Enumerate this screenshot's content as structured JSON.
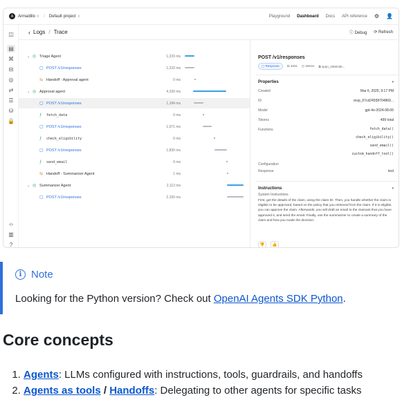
{
  "topbar": {
    "org_initial": "A",
    "org": "Armadillo",
    "project": "Default project",
    "links": [
      "Playground",
      "Dashboard",
      "Docs",
      "API reference"
    ],
    "active_link": "Dashboard"
  },
  "page_header": {
    "crumb1": "Logs",
    "crumb2": "Trace",
    "debug_label": "Debug",
    "refresh_label": "Refresh"
  },
  "trace": {
    "rows": [
      {
        "label": "Triage Agent",
        "duration": "1,233 ms"
      },
      {
        "label": "POST /v1/responses",
        "duration": "1,233 ms"
      },
      {
        "label": "Handoff",
        "target": "Approval agent",
        "duration": "0 ms"
      },
      {
        "label": "Approval agent",
        "duration": "4,330 ms"
      },
      {
        "label": "POST /v1/responses",
        "duration": "1,184 ms"
      },
      {
        "label": "fetch_data",
        "duration": "0 ms"
      },
      {
        "label": "POST /v1/responses",
        "duration": "1,071 ms"
      },
      {
        "label": "check_eligibility",
        "duration": "0 ms"
      },
      {
        "label": "POST /v1/responses",
        "duration": "1,830 ms"
      },
      {
        "label": "send_email",
        "duration": "0 ms"
      },
      {
        "label": "Handoff",
        "target": "Summarizer Agent",
        "duration": "1 ms"
      },
      {
        "label": "Summarizer Agent",
        "duration": "2,113 ms"
      },
      {
        "label": "POST /v1/responses",
        "duration": "2,150 ms"
      }
    ]
  },
  "detail": {
    "title": "POST /v1/responses",
    "badge": "Response",
    "tokens_badge": "4931",
    "time_badge": "184ms",
    "span_badge": "span_1992c85...",
    "properties_label": "Properties",
    "properties": [
      {
        "key": "Created",
        "value": "Mar 6, 2025, 9:17 PM"
      },
      {
        "key": "ID",
        "value": "resp_67cd24558704869..."
      },
      {
        "key": "Model",
        "value": "gpt-4o-2024-08-06"
      },
      {
        "key": "Tokens",
        "value": "499 total"
      }
    ],
    "functions_label": "Functions",
    "functions": [
      "fetch_data()",
      "check_eligibility()",
      "send_email()",
      "custom_handoff_tool()"
    ],
    "configuration_label": "Configuration",
    "response_label": "Response",
    "response_value": "text",
    "instructions_label": "Instructions",
    "system_instructions_label": "System Instructions",
    "instructions_text": "First, get the details of the claim, using the claim ID. Then, you handle whether the claim is eligible to be approved, based on the policy that you retrieved from the claim. If it is eligible, you can approve the claim. Afterwards, you will draft an email to the claimant that you have approved it, and send the email. Finally, use the summarizer to create a summary of the claim and how you made the decision."
  },
  "note": {
    "title": "Note",
    "text_before": "Looking for the Python version? Check out ",
    "link": "OpenAI Agents SDK Python",
    "text_after": "."
  },
  "core": {
    "heading": "Core concepts",
    "item1_link": "Agents",
    "item1_text": ": LLMs configured with instructions, tools, guardrails, and handoffs",
    "item2_link_a": "Agents as tools",
    "item2_sep": " / ",
    "item2_link_b": "Handoffs",
    "item2_text": ": Delegating to other agents for specific tasks"
  },
  "colors": {
    "accent": "#2f6fde",
    "bar_blue": "#3aa0e8",
    "bar_gray": "#b9b9c9"
  }
}
